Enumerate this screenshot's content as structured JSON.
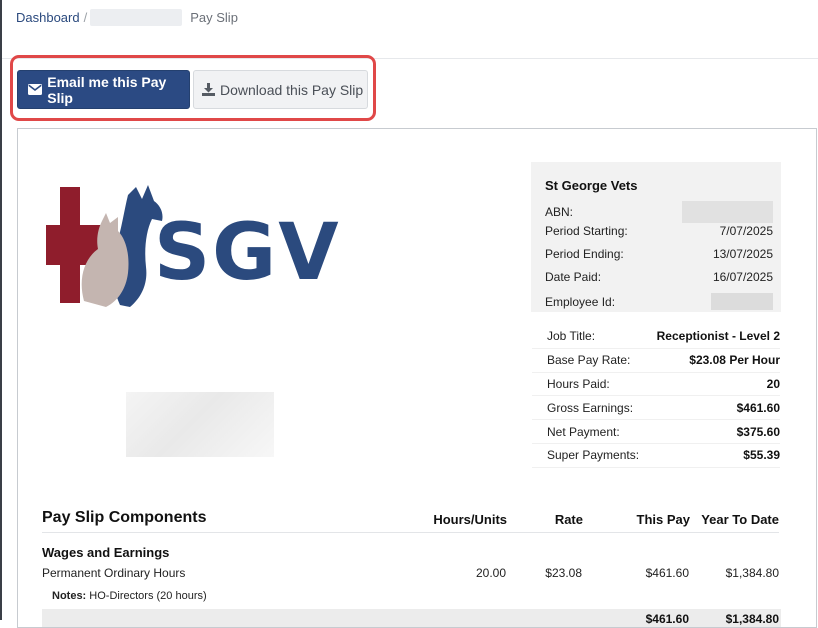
{
  "breadcrumb": {
    "home": "Dashboard",
    "separator": "/",
    "current": "Pay Slip"
  },
  "actions": {
    "email_label": "Email me this Pay Slip",
    "email_icon": "envelope-icon",
    "download_label": "Download this Pay Slip",
    "download_icon": "download-icon",
    "highlight_color": "#e04848",
    "primary_color": "#2b4a83"
  },
  "logo": {
    "text": "SGV",
    "brand_color": "#2b4a7e",
    "cross_color": "#8f1d2c"
  },
  "employer": {
    "name": "St George Vets",
    "rows": [
      {
        "label": "ABN:",
        "value": ""
      },
      {
        "label": "Period Starting:",
        "value": "7/07/2025"
      },
      {
        "label": "Period Ending:",
        "value": "13/07/2025"
      },
      {
        "label": "Date Paid:",
        "value": "16/07/2025"
      },
      {
        "label": "Employee Id:",
        "value": ""
      }
    ]
  },
  "job": [
    {
      "label": "Job Title:",
      "value": "Receptionist - Level 2"
    },
    {
      "label": "Base Pay Rate:",
      "value": "$23.08 Per Hour"
    },
    {
      "label": "Hours Paid:",
      "value": "20"
    },
    {
      "label": "Gross Earnings:",
      "value": "$461.60"
    },
    {
      "label": "Net Payment:",
      "value": "$375.60"
    },
    {
      "label": "Super Payments:",
      "value": "$55.39"
    }
  ],
  "components": {
    "title": "Pay Slip Components",
    "columns": [
      "Hours/Units",
      "Rate",
      "This Pay",
      "Year To Date"
    ],
    "section": "Wages and Earnings",
    "rows": [
      {
        "name": "Permanent Ordinary Hours",
        "hours": "20.00",
        "rate": "$23.08",
        "this_pay": "$461.60",
        "ytd": "$1,384.80"
      }
    ],
    "notes_label": "Notes:",
    "notes_text": "HO-Directors (20 hours)",
    "total": {
      "this_pay": "$461.60",
      "ytd": "$1,384.80"
    }
  }
}
